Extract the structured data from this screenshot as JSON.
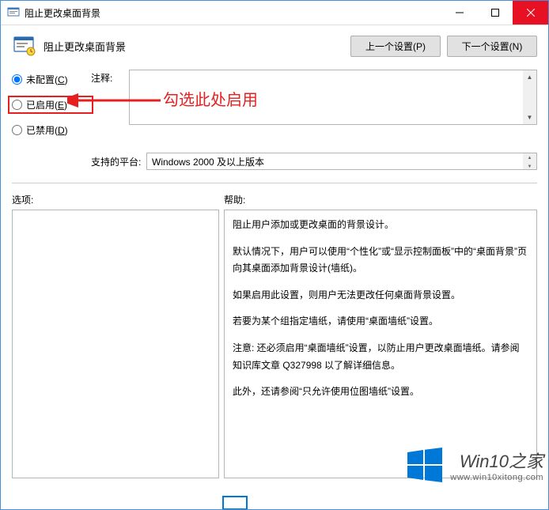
{
  "title": "阻止更改桌面背景",
  "header_title": "阻止更改桌面背景",
  "nav": {
    "prev": "上一个设置(P)",
    "next": "下一个设置(N)"
  },
  "radios": {
    "not_configured": "未配置(C)",
    "enabled": "已启用(E)",
    "disabled": "已禁用(D)",
    "selected": "not_configured"
  },
  "labels": {
    "comment": "注释:",
    "platform": "支持的平台:",
    "options": "选项:",
    "help": "帮助:"
  },
  "platform_text": "Windows 2000 及以上版本",
  "help_paragraphs": [
    "阻止用户添加或更改桌面的背景设计。",
    "默认情况下，用户可以使用“个性化”或“显示控制面板”中的“桌面背景”页向其桌面添加背景设计(墙纸)。",
    "如果启用此设置，则用户无法更改任何桌面背景设置。",
    "若要为某个组指定墙纸，请使用“桌面墙纸”设置。",
    "注意: 还必须启用“桌面墙纸”设置，以防止用户更改桌面墙纸。请参阅知识库文章 Q327998 以了解详细信息。",
    "此外，还请参阅“只允许使用位图墙纸”设置。"
  ],
  "annotation": "勾选此处启用",
  "watermark": {
    "brand": "Win10之家",
    "url": "www.win10xitong.com"
  }
}
